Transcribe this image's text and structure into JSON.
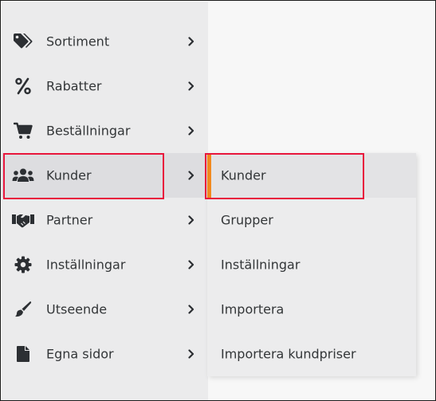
{
  "sidebar": {
    "items": [
      {
        "label": "Sortiment",
        "icon": "tag-icon"
      },
      {
        "label": "Rabatter",
        "icon": "percent-icon"
      },
      {
        "label": "Beställningar",
        "icon": "cart-icon"
      },
      {
        "label": "Kunder",
        "icon": "users-icon",
        "active": true
      },
      {
        "label": "Partner",
        "icon": "handshake-icon"
      },
      {
        "label": "Inställningar",
        "icon": "gear-icon"
      },
      {
        "label": "Utseende",
        "icon": "paintbrush-icon"
      },
      {
        "label": "Egna sidor",
        "icon": "file-icon"
      }
    ]
  },
  "submenu": {
    "items": [
      {
        "label": "Kunder",
        "active": true
      },
      {
        "label": "Grupper"
      },
      {
        "label": "Inställningar"
      },
      {
        "label": "Importera"
      },
      {
        "label": "Importera kundpriser"
      }
    ]
  },
  "colors": {
    "accent": "#f18a1f",
    "highlight": "#e8163c",
    "text": "#333638",
    "icon": "#2c2f33"
  }
}
